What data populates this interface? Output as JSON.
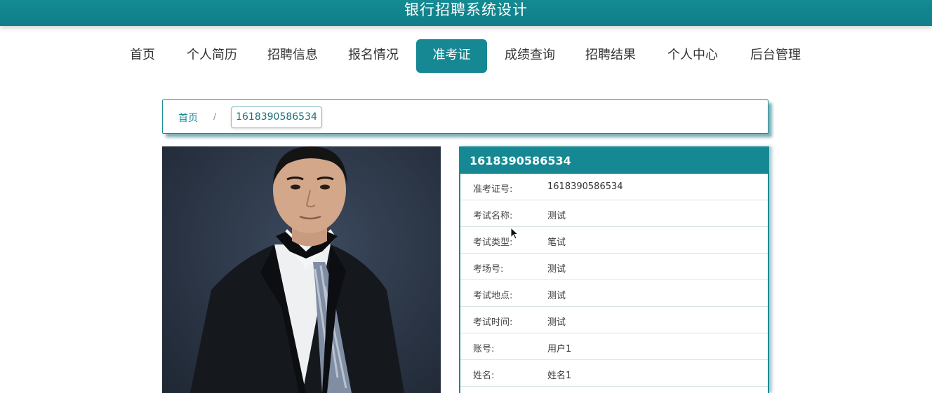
{
  "header": {
    "title": "银行招聘系统设计"
  },
  "nav": {
    "items": [
      {
        "label": "首页"
      },
      {
        "label": "个人简历"
      },
      {
        "label": "招聘信息"
      },
      {
        "label": "报名情况"
      },
      {
        "label": "准考证"
      },
      {
        "label": "成绩查询"
      },
      {
        "label": "招聘结果"
      },
      {
        "label": "个人中心"
      },
      {
        "label": "后台管理"
      }
    ],
    "active_index": 4
  },
  "breadcrumb": {
    "home": "首页",
    "separator": "/",
    "current": "1618390586534"
  },
  "detail": {
    "title": "1618390586534",
    "rows": [
      {
        "label": "准考证号:",
        "value": "1618390586534"
      },
      {
        "label": "考试名称:",
        "value": "测试"
      },
      {
        "label": "考试类型:",
        "value": "笔试"
      },
      {
        "label": "考场号:",
        "value": "测试"
      },
      {
        "label": "考试地点:",
        "value": "测试"
      },
      {
        "label": "考试时间:",
        "value": "测试"
      },
      {
        "label": "账号:",
        "value": "用户1"
      },
      {
        "label": "姓名:",
        "value": "姓名1"
      }
    ]
  },
  "theme": {
    "accent": "#158893",
    "header": "#148a93"
  }
}
